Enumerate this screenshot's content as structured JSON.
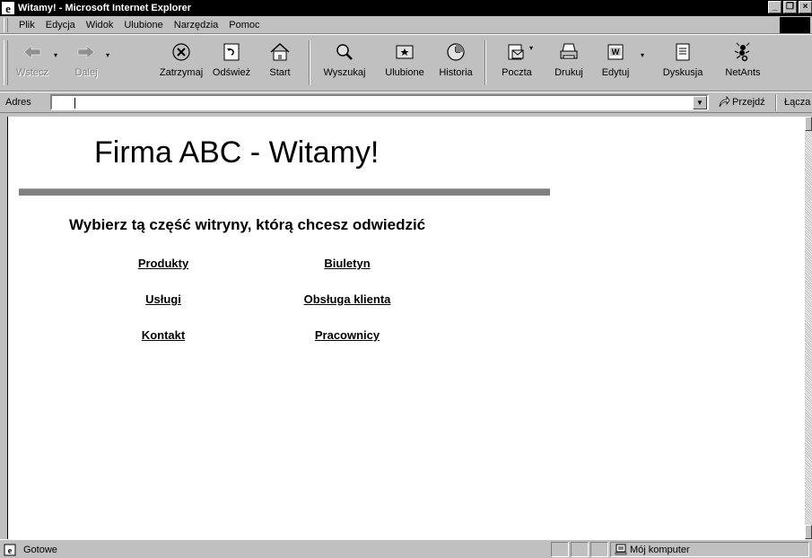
{
  "window": {
    "title": "Witamy! - Microsoft Internet Explorer"
  },
  "menu": [
    "Plik",
    "Edycja",
    "Widok",
    "Ulubione",
    "Narzędzia",
    "Pomoc"
  ],
  "toolbar": {
    "back": "Wstecz",
    "forward": "Dalej",
    "stop": "Zatrzymaj",
    "refresh": "Odśwież",
    "home": "Start",
    "search": "Wyszukaj",
    "favorites": "Ulubione",
    "history": "Historia",
    "mail": "Poczta",
    "print": "Drukuj",
    "edit": "Edytuj",
    "discuss": "Dyskusja",
    "netants": "NetAnts"
  },
  "address": {
    "label": "Adres",
    "value": "",
    "go": "Przejdź",
    "links": "Łącza"
  },
  "page": {
    "title": "Firma ABC - Witamy!",
    "subtitle": "Wybierz tą część witryny, którą chcesz odwiedzić",
    "links": [
      "Produkty",
      "Biuletyn",
      "Usługi",
      "Obsługa klienta",
      "Kontakt",
      "Pracownicy"
    ]
  },
  "status": {
    "text": "Gotowe",
    "zone": "Mój komputer"
  }
}
